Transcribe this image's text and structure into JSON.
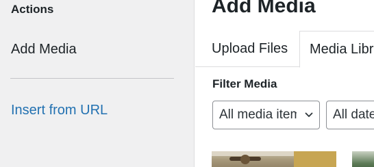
{
  "sidebar": {
    "heading": "Actions",
    "active_item": "Add Media",
    "link_item": "Insert from URL"
  },
  "main": {
    "title": "Add Media",
    "tabs": [
      {
        "label": "Upload Files",
        "active": false
      },
      {
        "label": "Media Library",
        "active": true
      }
    ],
    "filter": {
      "heading": "Filter Media",
      "type_select": "All media items",
      "date_select": "All dates"
    }
  },
  "icons": {
    "select_arrow": "chevron-down-icon"
  },
  "colors": {
    "link": "#2271b1",
    "sidebar_bg": "#f0f0f1",
    "border": "#dcdcde"
  }
}
